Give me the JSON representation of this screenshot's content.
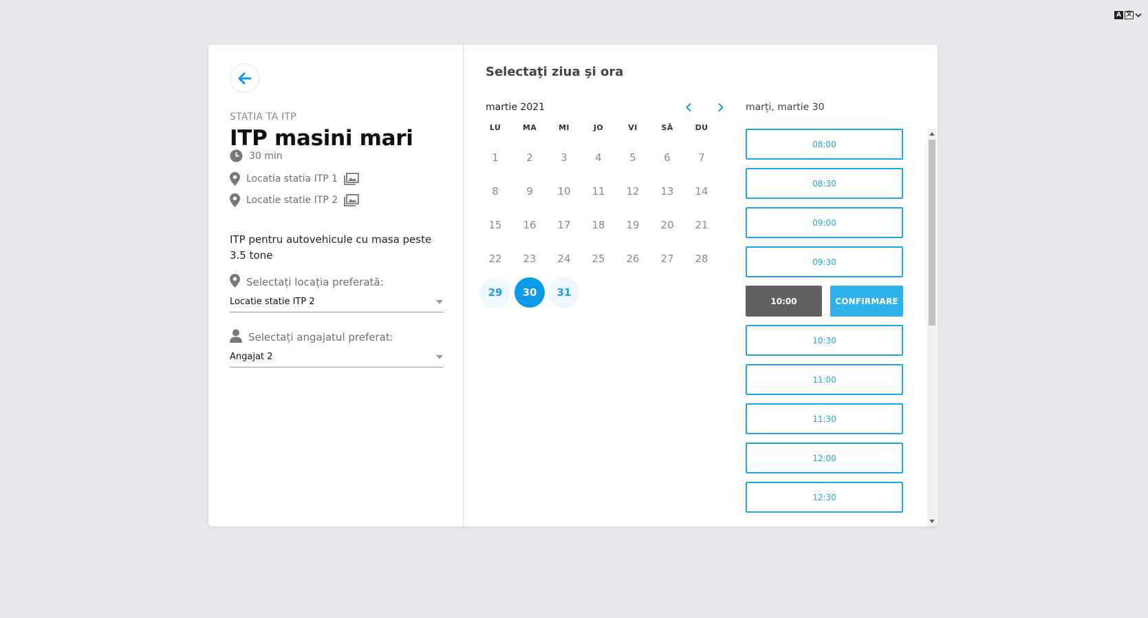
{
  "colors": {
    "accent": "#0a9ae8",
    "slot_border": "#1fa6e3",
    "confirm": "#2db3ea",
    "picked": "#5f5f5f",
    "page_bg": "#e9eaed"
  },
  "language_switch": {
    "a": "A",
    "b": "文"
  },
  "back_icon": "arrow-left-icon",
  "provider": {
    "eyebrow": "STATIA TA ITP",
    "title": "ITP masini mari",
    "duration": "30 min",
    "locations": [
      "Locatia statia ITP 1",
      "Locatie statie ITP 2"
    ],
    "description": "ITP pentru autovehicule cu masa peste 3.5 tone"
  },
  "location_field": {
    "label": "Selectați locația preferată:",
    "value": "Locatie statie ITP 2"
  },
  "employee_field": {
    "label": "Selectați angajatul preferat:",
    "value": "Angajat 2"
  },
  "calendar": {
    "section_title": "Selectaţi ziua şi ora",
    "month": "martie 2021",
    "weekdays": [
      "LU",
      "MA",
      "MI",
      "JO",
      "VI",
      "SÂ",
      "DU"
    ],
    "days": [
      "1",
      "2",
      "3",
      "4",
      "5",
      "6",
      "7",
      "8",
      "9",
      "10",
      "11",
      "12",
      "13",
      "14",
      "15",
      "16",
      "17",
      "18",
      "19",
      "20",
      "21",
      "22",
      "23",
      "24",
      "25",
      "26",
      "27",
      "28",
      "29",
      "30",
      "31"
    ],
    "available_days": [
      "29",
      "31"
    ],
    "selected_day": "30"
  },
  "schedule": {
    "selected_date": "marți, martie 30",
    "slots_before": [
      "08:00",
      "08:30",
      "09:00",
      "09:30"
    ],
    "picked_slot": "10:00",
    "confirm_label": "CONFIRMARE",
    "slots_after": [
      "10:30",
      "11:00",
      "11:30",
      "12:00",
      "12:30"
    ]
  }
}
